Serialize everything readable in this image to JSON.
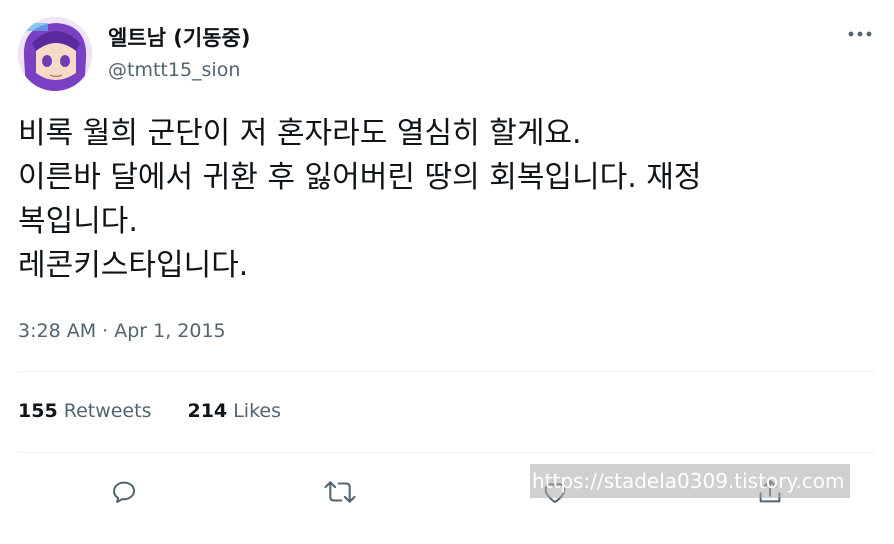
{
  "author": {
    "display_name": "엘트남 (기동중)",
    "handle": "@tmtt15_sion"
  },
  "tweet": {
    "lines": [
      "비록 월희 군단이 저 혼자라도 열심히 할게요.",
      "이른바 달에서 귀환 후 잃어버린 땅의 회복입니다. 재정",
      "복입니다.",
      "레콘키스타입니다."
    ],
    "timestamp": "3:28 AM · Apr 1, 2015"
  },
  "stats": {
    "retweets_count": "155",
    "retweets_label": "Retweets",
    "likes_count": "214",
    "likes_label": "Likes"
  },
  "actions": [
    "reply-icon",
    "retweet-icon",
    "like-icon",
    "share-icon"
  ],
  "watermark": "https://stadela0309.tistory.com",
  "colors": {
    "text_primary": "#0f1419",
    "text_secondary": "#536471",
    "divider": "#eff3f4"
  }
}
